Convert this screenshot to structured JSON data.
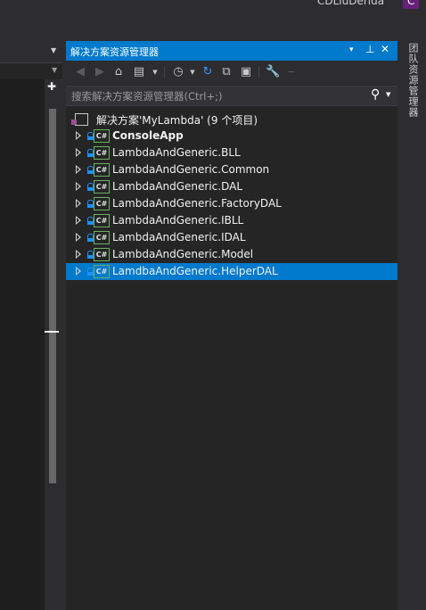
{
  "window": {
    "user_name": "CDLiuDerida",
    "user_badge": "C"
  },
  "solution_explorer": {
    "title": "解决方案资源管理器",
    "title_buttons": {
      "dropdown": "▾",
      "pin": "⊥",
      "close": "✕"
    },
    "search_placeholder": "搜索解决方案资源管理器(Ctrl+;)",
    "toolbar": [
      "back-icon",
      "forward-icon",
      "home-icon",
      "switch-views-icon",
      "pending-changes-filter-icon",
      "refresh-icon",
      "collapse-all-icon",
      "show-all-files-icon",
      "properties-icon",
      "preview-icon"
    ],
    "solution_label": "解决方案'MyLambda' (9 个项目)",
    "projects": [
      {
        "label": "ConsoleApp",
        "bold": true,
        "selected": false
      },
      {
        "label": "LambdaAndGeneric.BLL",
        "bold": false,
        "selected": false
      },
      {
        "label": "LambdaAndGeneric.Common",
        "bold": false,
        "selected": false
      },
      {
        "label": "LambdaAndGeneric.DAL",
        "bold": false,
        "selected": false
      },
      {
        "label": "LambdaAndGeneric.FactoryDAL",
        "bold": false,
        "selected": false
      },
      {
        "label": "LambdaAndGeneric.IBLL",
        "bold": false,
        "selected": false
      },
      {
        "label": "LambdaAndGeneric.IDAL",
        "bold": false,
        "selected": false
      },
      {
        "label": "LambdaAndGeneric.Model",
        "bold": false,
        "selected": false
      },
      {
        "label": "LamdbaAndGeneric.HelperDAL",
        "bold": false,
        "selected": true
      }
    ],
    "project_icon_text": "C#"
  },
  "right_tabs": {
    "team_explorer": "团队资源管理器"
  },
  "colors": {
    "accent": "#007acc",
    "background": "#252526",
    "chrome": "#2d2d30"
  }
}
